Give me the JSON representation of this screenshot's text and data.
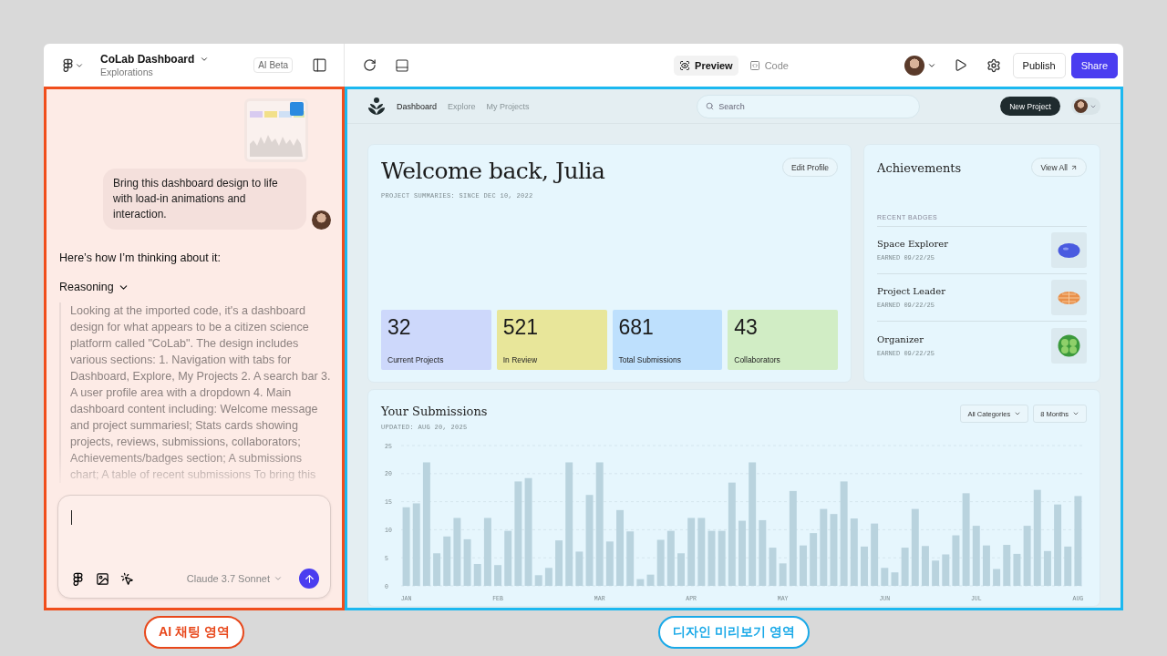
{
  "project": {
    "title": "CoLab Dashboard",
    "subtitle": "Explorations"
  },
  "ai_badge": "AI Beta",
  "view_tabs": [
    {
      "label": "Preview",
      "selected": true
    },
    {
      "label": "Code",
      "selected": false
    }
  ],
  "buttons": {
    "publish": "Publish",
    "share": "Share"
  },
  "chat": {
    "user_message": "Bring this dashboard design to life with load-in animations and interaction.",
    "intro": "Here’s how I’m thinking about it:",
    "reasoning": {
      "label": "Reasoning",
      "expanded": true,
      "text": "Looking at the imported code, it's a dashboard design for what appears to be a citizen science platform called \"CoLab\". The design includes various sections: 1. Navigation with tabs for Dashboard, Explore, My Projects 2. A search bar 3. A user profile area with a dropdown 4. Main dashboard content including: Welcome message and project summariesl; Stats cards showing projects, reviews, submissions, collaborators; Achievements/badges section; A submissions chart; A table of recent submissions To bring this"
    },
    "composer": {
      "model": "Claude 3.7 Sonnet"
    }
  },
  "preview": {
    "nav": [
      {
        "label": "Dashboard",
        "selected": true
      },
      {
        "label": "Explore",
        "selected": false
      },
      {
        "label": "My Projects",
        "selected": false
      }
    ],
    "search": {
      "placeholder": "Search"
    },
    "new_project": "New Project",
    "welcome": {
      "title": "Welcome back, Julia",
      "subtitle": "PROJECT SUMMARIES: SINCE DEC 10, 2022",
      "edit": "Edit Profile"
    },
    "stats": [
      {
        "value": "32",
        "label": "Current Projects",
        "color": "#cdd8fb"
      },
      {
        "value": "521",
        "label": "In Review",
        "color": "#e8e69a"
      },
      {
        "value": "681",
        "label": "Total Submissions",
        "color": "#bee0fd"
      },
      {
        "value": "43",
        "label": "Collaborators",
        "color": "#d1edc5"
      }
    ],
    "achievements": {
      "title": "Achievements",
      "view_all": "View All",
      "section": "RECENT BADGES",
      "badges": [
        {
          "name": "Space Explorer",
          "earned": "EARNED 09/22/25",
          "kind": "planet"
        },
        {
          "name": "Project Leader",
          "earned": "EARNED 09/22/25",
          "kind": "globe"
        },
        {
          "name": "Organizer",
          "earned": "EARNED 09/22/25",
          "kind": "leaf"
        }
      ]
    },
    "submissions": {
      "title": "Your Submissions",
      "updated": "UPDATED: AUG 20, 2025",
      "filters": [
        "All Categories",
        "8 Months"
      ],
      "chart_data": {
        "type": "bar",
        "categories": [
          "JAN",
          null,
          null,
          null,
          null,
          null,
          null,
          null,
          null,
          "FEB",
          null,
          null,
          null,
          null,
          null,
          null,
          null,
          null,
          null,
          "MAR",
          null,
          null,
          null,
          null,
          null,
          null,
          null,
          null,
          "APR",
          null,
          null,
          null,
          null,
          null,
          null,
          null,
          null,
          "MAY",
          null,
          null,
          null,
          null,
          null,
          null,
          null,
          null,
          null,
          "JUN",
          null,
          null,
          null,
          null,
          null,
          null,
          null,
          null,
          "JUL",
          null,
          null,
          null,
          null,
          null,
          null,
          null,
          null,
          null,
          "AUG"
        ],
        "series": [
          {
            "color": "#b9d3de",
            "values": [
              14,
              14.7,
              22,
              5.8,
              8.8,
              12.1,
              8.3,
              3.9,
              12.1,
              3.7,
              9.8,
              18.6,
              19.2,
              1.9,
              3.2,
              8.1,
              22,
              6.1,
              16.2,
              22,
              7.9,
              13.5,
              9.7,
              1.2,
              2,
              8.2,
              9.8,
              5.8,
              12.1,
              12.1,
              9.8,
              9.8,
              18.4,
              11.6,
              22,
              11.7,
              6.8,
              4,
              16.9,
              7.2,
              9.4,
              13.7,
              12.8,
              18.6,
              12,
              7,
              11.1,
              3.2,
              2.4,
              6.8,
              13.7,
              7.1,
              4.5,
              5.6,
              9,
              16.5,
              10.7,
              7.2,
              3,
              7.3,
              5.7,
              10.7,
              17.1,
              6.2,
              14.5,
              7,
              16
            ]
          }
        ],
        "ylim": [
          0,
          25
        ],
        "yticks": [
          0,
          5,
          10,
          15,
          20,
          25
        ],
        "grid": true
      }
    }
  },
  "area_labels": [
    {
      "label": "AI 채팅 영역",
      "color": "#e8471a"
    },
    {
      "label": "디자인 미리보기 영역",
      "color": "#1aa9e8"
    }
  ]
}
